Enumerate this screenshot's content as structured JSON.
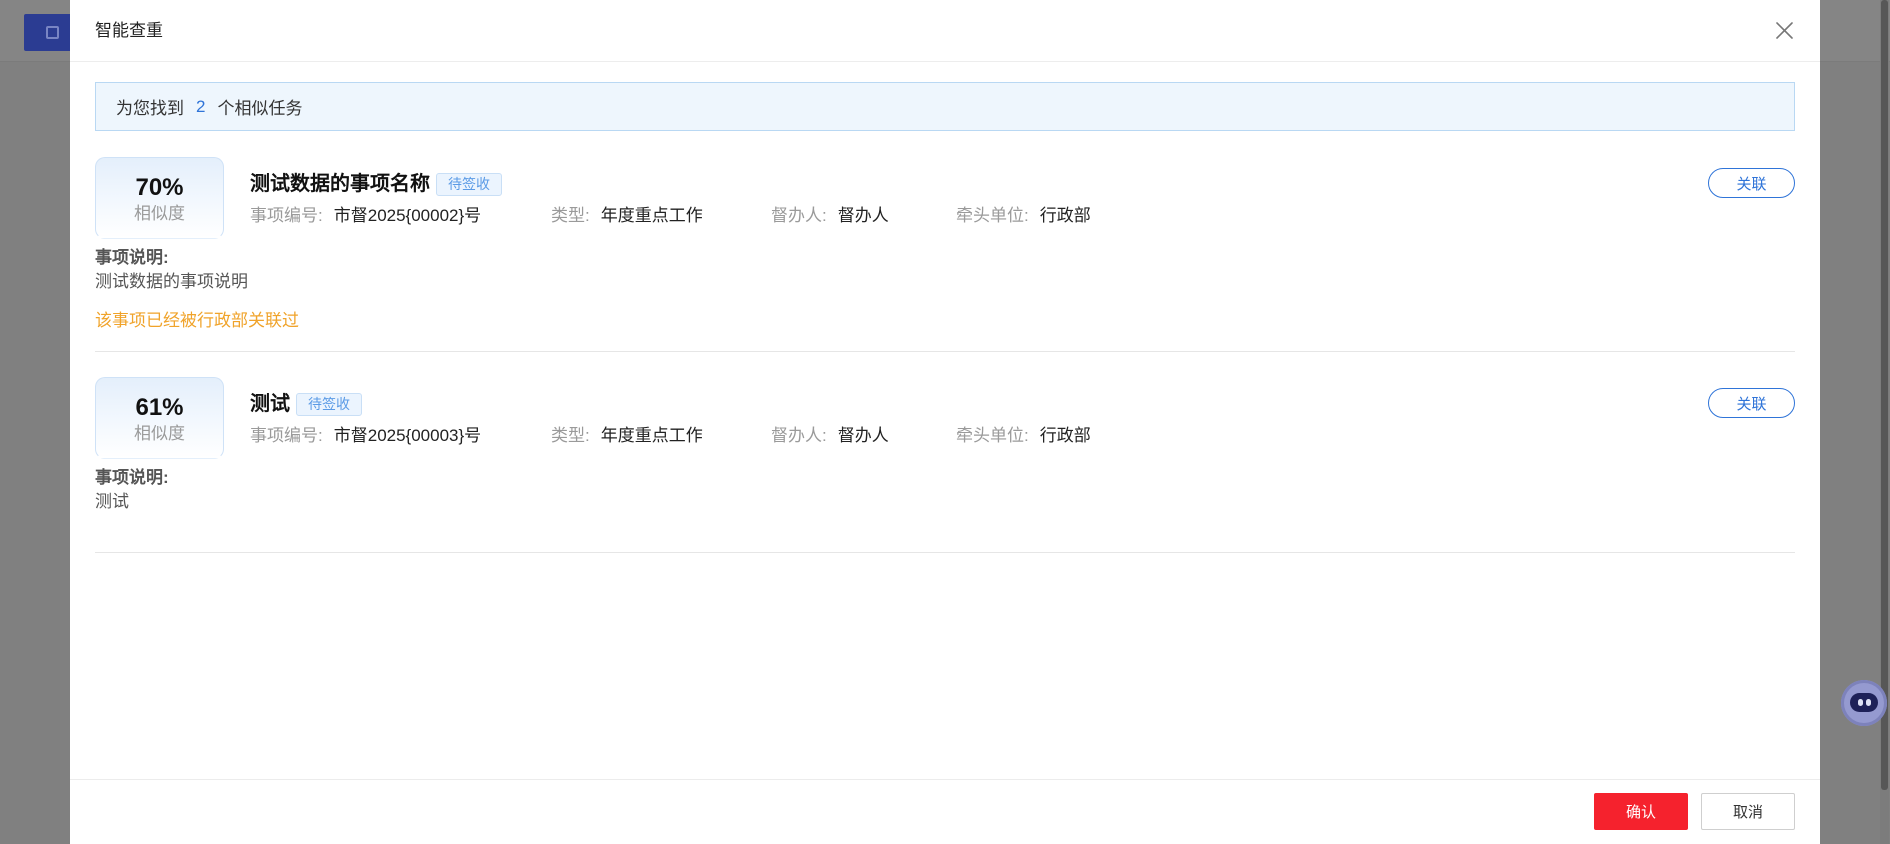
{
  "dialog": {
    "title": "智能查重"
  },
  "summary": {
    "prefix": "为您找到",
    "count": "2",
    "suffix": "个相似任务"
  },
  "results": [
    {
      "similarity": "70%",
      "similarity_label": "相似度",
      "title": "测试数据的事项名称",
      "status": "待签收",
      "meta": [
        {
          "label": "事项编号:",
          "value": "市督2025{00002}号"
        },
        {
          "label": "类型:",
          "value": "年度重点工作"
        },
        {
          "label": "督办人:",
          "value": "督办人"
        },
        {
          "label": "牵头单位:",
          "value": "行政部"
        }
      ],
      "action_label": "关联",
      "description_label": "事项说明:",
      "description": "测试数据的事项说明",
      "note": "该事项已经被行政部关联过"
    },
    {
      "similarity": "61%",
      "similarity_label": "相似度",
      "title": "测试",
      "status": "待签收",
      "meta": [
        {
          "label": "事项编号:",
          "value": "市督2025{00003}号"
        },
        {
          "label": "类型:",
          "value": "年度重点工作"
        },
        {
          "label": "督办人:",
          "value": "督办人"
        },
        {
          "label": "牵头单位:",
          "value": "行政部"
        }
      ],
      "action_label": "关联",
      "description_label": "事项说明:",
      "description": "测试"
    }
  ],
  "footer": {
    "confirm_label": "确认",
    "cancel_label": "取消"
  },
  "icons": {
    "close": "close-icon",
    "assistant": "robot-icon",
    "background_button": "save-icon"
  },
  "colors": {
    "accent": "#2f74d8",
    "note": "#f0a32a",
    "confirm": "#f5222d",
    "tag_text": "#5b9be6",
    "tag_bg": "#ebf4fe",
    "banner_bg": "#eef6fd",
    "overlay": "#808080"
  }
}
